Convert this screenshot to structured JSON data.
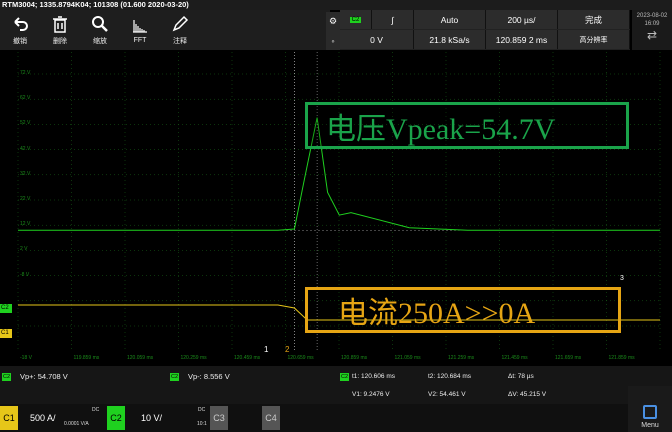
{
  "title": "RTM3004; 1335.8794K04; 101308 (01.600 2020-03-20)",
  "toolbar": [
    {
      "label": "撤销",
      "icon": "undo-icon"
    },
    {
      "label": "删除",
      "icon": "trash-icon"
    },
    {
      "label": "缩放",
      "icon": "zoom-icon"
    },
    {
      "label": "FFT",
      "icon": "fft-icon"
    },
    {
      "label": "注释",
      "icon": "pen-icon"
    }
  ],
  "trigger": {
    "source": "C2",
    "slope": "∫",
    "mode": "Auto",
    "timebase": "200 µs/",
    "status": "完成",
    "level": "0 V",
    "sample_rate": "21.8 kSa/s",
    "record": "120.859 2 ms",
    "resolution": "高分辨率"
  },
  "clock": {
    "date": "2023-08-02",
    "time": "16:09"
  },
  "plot": {
    "y_ticks": [
      "72 V",
      "62 V",
      "52 V",
      "42 V",
      "32 V",
      "22 V",
      "12 V",
      "2 V",
      "-8 V",
      "-18 V"
    ],
    "x_ticks": [
      "-18 V",
      "119.859 ms",
      "120.059 ms",
      "120.259 ms",
      "120.459 ms",
      "120.659 ms",
      "120.859 ms",
      "121.059 ms",
      "121.259 ms",
      "121.459 ms",
      "121.659 ms",
      "121.859 ms"
    ],
    "cursor1": "1",
    "cursor2": "2",
    "level_marker": "3",
    "c2_marker": "C2",
    "c1_marker": "C1"
  },
  "annotations": {
    "voltage": "电压Vpeak=54.7V",
    "current": "电流250A>>0A"
  },
  "measurements": {
    "vp_plus_label": "Vp+: 54.708 V",
    "vp_minus_label": "Vp-: 8.556 V",
    "t1": "t1: 120.606 ms",
    "t2": "t2: 120.684 ms",
    "dt": "Δt: 78 µs",
    "v1": "V1: 9.2476 V",
    "v2": "V2: 54.461 V",
    "dv": "ΔV: 45.215 V"
  },
  "channels": [
    {
      "name": "C1",
      "scale": "500 A/",
      "coupling": "DC",
      "extra": "0.0001 V/A",
      "color": "#e6c619",
      "on": true
    },
    {
      "name": "C2",
      "scale": "10 V/",
      "coupling": "DC",
      "extra": "10:1",
      "color": "#1fd11f",
      "on": true
    },
    {
      "name": "C3",
      "scale": "",
      "coupling": "",
      "extra": "",
      "color": "#777777",
      "on": false
    },
    {
      "name": "C4",
      "scale": "",
      "coupling": "",
      "extra": "",
      "color": "#777777",
      "on": false
    }
  ],
  "menu": "Menu",
  "chart_data": {
    "type": "line",
    "xlabel": "",
    "ylabel": "",
    "x_range_ms": [
      119.659,
      121.859
    ],
    "series": [
      {
        "name": "C2",
        "x_ms": [
          119.659,
          120.55,
          120.606,
          120.64,
          120.684,
          120.72,
          120.76,
          120.8,
          121.0,
          121.2,
          121.5,
          121.859
        ],
        "y_v": [
          10,
          10,
          10.5,
          30,
          54.7,
          25,
          16,
          17,
          11,
          10,
          10,
          10
        ]
      },
      {
        "name": "C1",
        "x_ms": [
          119.659,
          120.55,
          120.606,
          120.65,
          121.859
        ],
        "y_a": [
          250,
          250,
          200,
          0,
          0
        ]
      }
    ]
  },
  "colors": {
    "c1": "#e6c619",
    "c2": "#1fd11f",
    "grid": "#1a6a1a",
    "annotation_v": "#1aa34a",
    "annotation_i": "#e6a514"
  }
}
